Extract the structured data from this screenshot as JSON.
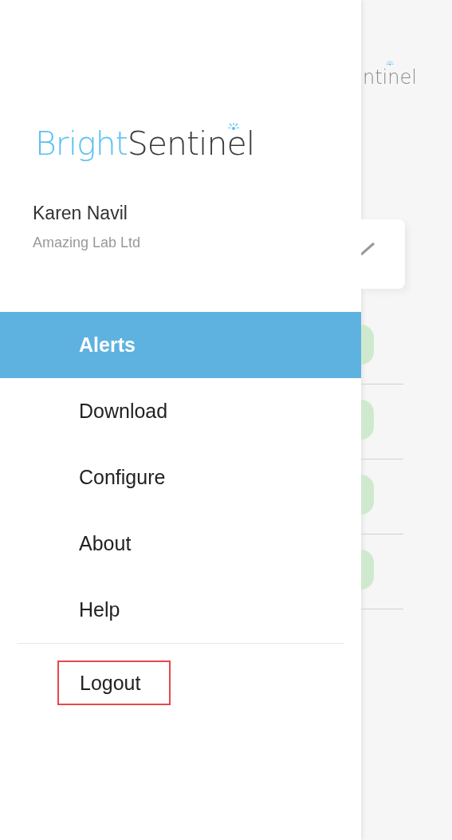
{
  "drawer": {
    "logo": {
      "first": "Bright",
      "second": "Sentinel"
    },
    "user": {
      "name": "Karen Navil",
      "organization": "Amazing Lab Ltd"
    },
    "menu": [
      {
        "label": "Alerts",
        "selected": true
      },
      {
        "label": "Download",
        "selected": false
      },
      {
        "label": "Configure",
        "selected": false
      },
      {
        "label": "About",
        "selected": false
      },
      {
        "label": "Help",
        "selected": false
      }
    ],
    "footer_menu": [
      {
        "label": "Logout",
        "highlighted": true
      }
    ]
  },
  "background": {
    "logo_fragment": "ntinel",
    "rows": [
      {
        "kind": "status"
      },
      {
        "kind": "status"
      },
      {
        "kind": "status"
      },
      {
        "kind": "status"
      }
    ]
  }
}
